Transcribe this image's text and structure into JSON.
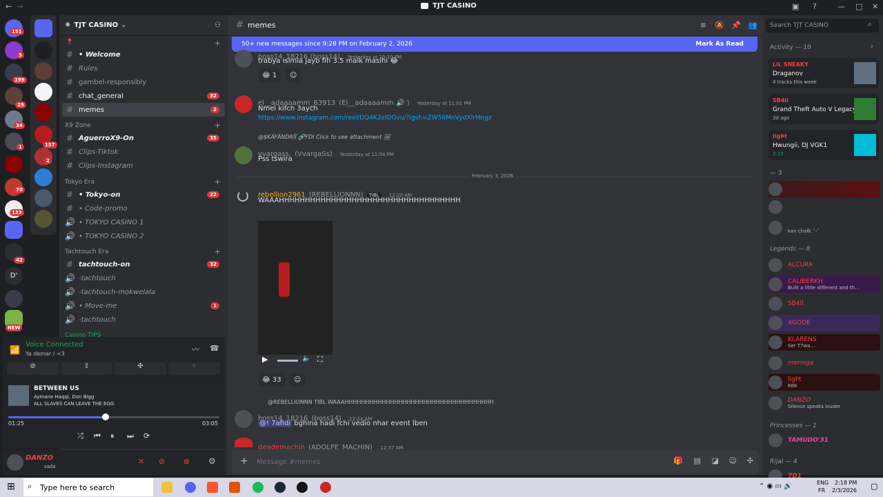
{
  "window": {
    "title": "TJT CASINO"
  },
  "server": {
    "name": "TJT CASINO"
  },
  "rail_badges": [
    "151",
    "5",
    "199",
    "29",
    "34",
    "1",
    "157",
    "2",
    "70",
    "133",
    "42"
  ],
  "rail_labels": {
    "d_label": "D'",
    "new": "NEW"
  },
  "channels": [
    {
      "name": "• Welcome",
      "style": "bold-italic"
    },
    {
      "name": "Rules",
      "style": "italic"
    },
    {
      "name": "gambel-responsibly",
      "style": "muted"
    },
    {
      "name": "chat_general",
      "style": "bold",
      "count": "32"
    },
    {
      "name": "memes",
      "style": "active",
      "count": "2"
    }
  ],
  "categories": {
    "x9": "X9 Zone",
    "tokyo": "Tokyo Era",
    "tachtouch": "Tachtouch Era",
    "casino_tips": "Casino TIPS"
  },
  "x9_channels": [
    {
      "name": "AguerroX9-On",
      "count": "35"
    },
    {
      "name": "Clips-Tiktok"
    },
    {
      "name": "Clips-Instagram"
    }
  ],
  "tokyo_channels": [
    {
      "name": "• Tokyo-on",
      "count": "22"
    },
    {
      "name": "• Code-promo"
    },
    {
      "name": "• TOKYO CASINO 1"
    },
    {
      "name": "• TOKYO CASINO 2"
    }
  ],
  "tachtouch_channels": [
    {
      "name": "tachtouch-on",
      "count": "32"
    },
    {
      "name": "-tachtouch"
    },
    {
      "name": "-tachtouch-mokwelala"
    },
    {
      "name": "• Move-me",
      "count": "1"
    },
    {
      "name": "-tachtouch"
    }
  ],
  "voice": {
    "status": "Voice Connected",
    "channel": "Ya damar / <3"
  },
  "music": {
    "title": "BETWEEN US",
    "artists": "Aymane Haqqi, Don Bigg",
    "album": "ALL SLAVES CAN LEAVE THE EGG",
    "elapsed": "01:25",
    "duration": "03:05",
    "progress": 0.46
  },
  "user": {
    "name": "DANZO",
    "status": "sada"
  },
  "main": {
    "channel": "memes",
    "banner": "50+ new messages since 9:28 PM on February 2, 2026",
    "mark_read": "Mark As Read",
    "composer_placeholder": "Message #memes",
    "divider": "February 3, 2026"
  },
  "messages": [
    {
      "name": "boss14_18216 (boss14)",
      "time": "Yesterday at 10:10 PM",
      "text": "trabya islmia jayb fih 3.5 malk masihi 😂",
      "react": "😂 1"
    },
    {
      "name": "el__adaaaamm_63913",
      "alias": "(El__adaaaamm 🔊 )",
      "time": "Yesterday at 11:01 PM",
      "text": "Nmel kifch 3aych",
      "link": "https://www.instagram.com/reel/DQ4K2elDGvu/?igsh=ZW56MnVydXlrMngz"
    },
    {
      "reply": "@$KÄFÄNDRÏÏ 🔗FDI Click to see attachment 🖼",
      "name": "vvargass.",
      "alias": "(VvargaSs)",
      "time": "Yesterday at 11:54 PM",
      "text": "Pss tswira"
    },
    {
      "name": "rebellion2961",
      "alias": "(REBELLIONNN)",
      "tag": "TIBL",
      "time": "12:20 AM",
      "text": "WAAAHHHHHHHHHHHHHHHHHHHHHHHHHHHHHHHHHHH",
      "react": "😂 33"
    },
    {
      "reply": "@REBELLIONNN TIBL WAAAHHHHHHHHHHHHHHHHHHHHHHHHHHHHHHHHHHHH",
      "name": "boss14_18216",
      "alias": "(boss14)",
      "time": "12:24 AM",
      "mention": "@! 7afidi",
      "text": "bghina hadi fchi vedio nhar event lben"
    },
    {
      "name": "deademachin",
      "alias": "(ADOLFE_MACHIN)",
      "time": "12:37 AM"
    }
  ],
  "members": {
    "search": "Search TJT CASINO",
    "activity_header": "Activity — 10",
    "activities": [
      {
        "name": "LiL SNEAKY",
        "title": "Draganov",
        "sub": "4 tracks this week"
      },
      {
        "name": "SB4ll",
        "title": "Grand Theft Auto V Legacy",
        "sub": "3d ago"
      },
      {
        "name": "ligÞt",
        "title": "Hwungii, DJ VGK1",
        "sub": "2:23"
      }
    ],
    "group1": "— 3",
    "group1_sub": "kan chofk ˆ-ˆ",
    "legends": "Legends — 8",
    "legend_members": [
      {
        "name": "ALCURA",
        "color": "#f23f43"
      },
      {
        "name": "CALIBERKH",
        "sub": "Built a little different and th...",
        "color": "#f23f43"
      },
      {
        "name": "SB4ll",
        "color": "#f23f43"
      },
      {
        "name": "XGODE",
        "color": "#f23f43"
      },
      {
        "name": "KLARENS",
        "sub": "Ser T7wa...",
        "color": "#f23f43"
      },
      {
        "name": "merniga",
        "color": "#f23f43"
      },
      {
        "name": "ligÞt",
        "sub": "666",
        "color": "#f23f43"
      },
      {
        "name": "DANZO",
        "sub": "Silence speaks louder",
        "color": "#f23f43"
      }
    ],
    "princesses": "Princesses — 1",
    "princess": "TAMUDO'31",
    "rijal": "Rijal — 4",
    "rijal_member": "7D1"
  },
  "taskbar": {
    "search": "Type here to search",
    "lang": "ENG",
    "region": "FR",
    "time": "2:18 PM",
    "date": "2/3/2026"
  }
}
